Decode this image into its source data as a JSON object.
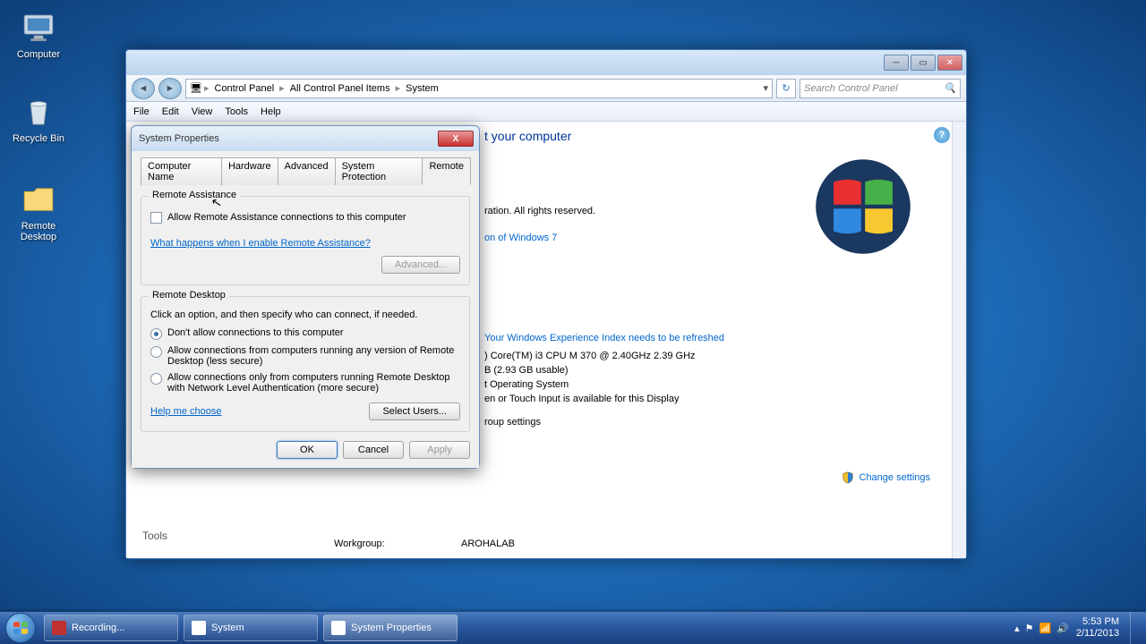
{
  "desktop": {
    "icons": [
      {
        "label": "Computer"
      },
      {
        "label": "Recycle Bin"
      },
      {
        "label": "Remote Desktop"
      }
    ]
  },
  "explorer": {
    "breadcrumb": [
      "Control Panel",
      "All Control Panel Items",
      "System"
    ],
    "search_placeholder": "Search Control Panel",
    "menu": [
      "File",
      "Edit",
      "View",
      "Tools",
      "Help"
    ],
    "page_title_suffix": "t your computer",
    "copyright_suffix": "ration.  All rights reserved.",
    "edition_suffix": "on of Windows 7",
    "experience_prefix": "Your Windows Experience Index needs to be refreshed",
    "processor_suffix": ") Core(TM) i3 CPU       M 370  @ 2.40GHz   2.39 GHz",
    "ram_suffix": "B (2.93 GB usable)",
    "systype_suffix": "t Operating System",
    "pen_suffix": "en or Touch Input is available for this Display",
    "workgroup_section": "roup settings",
    "change_settings": "Change settings",
    "tools_label": "Tools",
    "workgroup_label": "Workgroup:",
    "workgroup_value": "AROHALAB"
  },
  "dialog": {
    "title": "System Properties",
    "tabs": [
      "Computer Name",
      "Hardware",
      "Advanced",
      "System Protection",
      "Remote"
    ],
    "active_tab": 4,
    "remote_assistance": {
      "title": "Remote Assistance",
      "checkbox": "Allow Remote Assistance connections to this computer",
      "link": "What happens when I enable Remote Assistance?",
      "advanced": "Advanced..."
    },
    "remote_desktop": {
      "title": "Remote Desktop",
      "instruction": "Click an option, and then specify who can connect, if needed.",
      "options": [
        "Don't allow connections to this computer",
        "Allow connections from computers running any version of Remote Desktop (less secure)",
        "Allow connections only from computers running Remote Desktop with Network Level Authentication (more secure)"
      ],
      "selected": 0,
      "help_link": "Help me choose",
      "select_users": "Select Users..."
    },
    "buttons": {
      "ok": "OK",
      "cancel": "Cancel",
      "apply": "Apply"
    }
  },
  "taskbar": {
    "items": [
      {
        "label": "Recording..."
      },
      {
        "label": "System"
      },
      {
        "label": "System Properties"
      }
    ],
    "time": "5:53 PM",
    "date": "2/11/2013"
  }
}
